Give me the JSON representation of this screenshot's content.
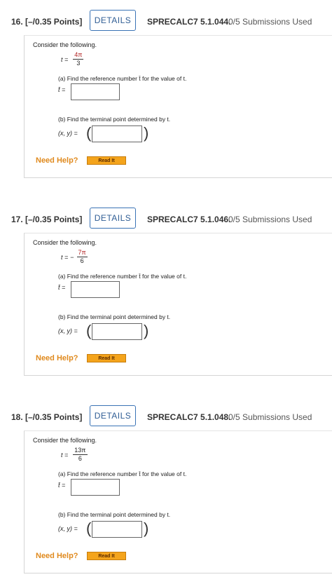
{
  "questions": [
    {
      "number_points": "16. [–/0.35 Points]",
      "details_label": "DETAILS",
      "code": "SPRECALC7 5.1.044.",
      "submissions": "0/5 Submissions Used",
      "consider": "Consider the following.",
      "t_label": "t =",
      "t_sign": "",
      "t_numerator": "4π",
      "t_denominator": "3",
      "part_a": "(a) Find the reference number t̄ for the value of t.",
      "tbar_label": "t̄ =",
      "part_b": "(b) Find the terminal point determined by t.",
      "xy_label": "(x, y) =",
      "need_help": "Need Help?",
      "read_it": "Read It"
    },
    {
      "number_points": "17. [–/0.35 Points]",
      "details_label": "DETAILS",
      "code": "SPRECALC7 5.1.046.",
      "submissions": "0/5 Submissions Used",
      "consider": "Consider the following.",
      "t_label": "t =",
      "t_sign": "−",
      "t_numerator": "7π",
      "t_denominator": "6",
      "part_a": "(a) Find the reference number t̄ for the value of t.",
      "tbar_label": "t̄ =",
      "part_b": "(b) Find the terminal point determined by t.",
      "xy_label": "(x, y) =",
      "need_help": "Need Help?",
      "read_it": "Read It"
    },
    {
      "number_points": "18. [–/0.35 Points]",
      "details_label": "DETAILS",
      "code": "SPRECALC7 5.1.048.",
      "submissions": "0/5 Submissions Used",
      "consider": "Consider the following.",
      "t_label": "t =",
      "t_sign": "",
      "t_numerator": "13π",
      "t_denominator": "6",
      "part_a": "(a) Find the reference number t̄ for the value of t.",
      "tbar_label": "t̄ =",
      "part_b": "(b) Find the terminal point determined by t.",
      "xy_label": "(x, y) =",
      "need_help": "Need Help?",
      "read_it": "Read It"
    }
  ],
  "colors": {
    "need_help": "#e08a1e",
    "details_border": "#3a73b5",
    "fraction_red": "#b22222",
    "read_it_bg": "#f4a41c"
  }
}
